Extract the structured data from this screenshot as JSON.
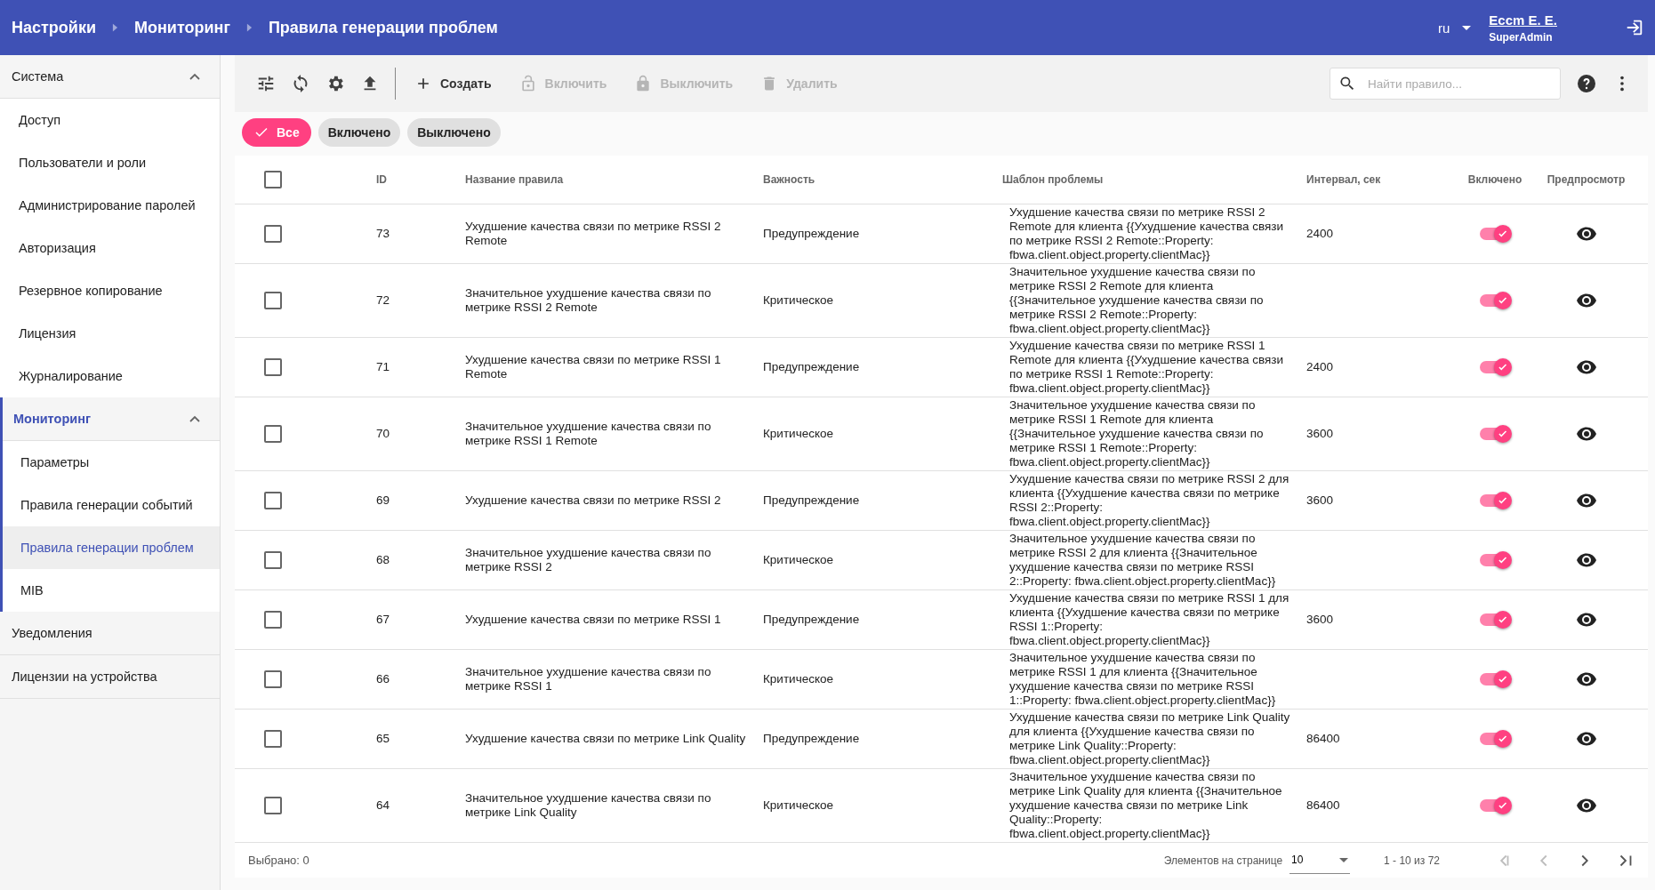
{
  "breadcrumbs": [
    "Настройки",
    "Мониторинг",
    "Правила генерации проблем"
  ],
  "language": "ru",
  "user": {
    "name": "Eccm E. E.",
    "role": "SuperAdmin"
  },
  "sidebar": {
    "sections": [
      {
        "label": "Система",
        "expanded": true,
        "selected": false,
        "children": [
          {
            "label": "Доступ",
            "selected": false
          },
          {
            "label": "Пользователи и роли",
            "selected": false
          },
          {
            "label": "Администрирование паролей",
            "selected": false
          },
          {
            "label": "Авторизация",
            "selected": false
          },
          {
            "label": "Резервное копирование",
            "selected": false
          },
          {
            "label": "Лицензия",
            "selected": false
          },
          {
            "label": "Журналирование",
            "selected": false
          }
        ]
      },
      {
        "label": "Мониторинг",
        "expanded": true,
        "selected": true,
        "children": [
          {
            "label": "Параметры",
            "selected": false
          },
          {
            "label": "Правила генерации событий",
            "selected": false
          },
          {
            "label": "Правила генерации проблем",
            "selected": true
          },
          {
            "label": "MIB",
            "selected": false
          }
        ]
      },
      {
        "label": "Уведомления",
        "selected": false
      },
      {
        "label": "Лицензии на устройства",
        "selected": false
      }
    ]
  },
  "toolbar": {
    "actions": [
      {
        "kind": "create",
        "label": "Создать",
        "disabled": false
      },
      {
        "kind": "enable",
        "label": "Включить",
        "disabled": true
      },
      {
        "kind": "disable",
        "label": "Выключить",
        "disabled": true
      },
      {
        "kind": "delete",
        "label": "Удалить",
        "disabled": true
      }
    ],
    "search": {
      "placeholder": "Найти правило..."
    }
  },
  "filters": [
    {
      "label": "Все",
      "selected": true
    },
    {
      "label": "Включено",
      "selected": false
    },
    {
      "label": "Выключено",
      "selected": false
    }
  ],
  "table": {
    "select_all_checked": false,
    "columns": [
      "ID",
      "Название правила",
      "Важность",
      "Шаблон проблемы",
      "Интервал, сек",
      "Включено",
      "Предпросмотр"
    ],
    "rows": [
      {
        "checked": false,
        "id": "73",
        "name": "Ухудшение качества связи по метрике RSSI 2 Remote",
        "severity": "Предупреждение",
        "template": "Ухудшение качества связи по метрике RSSI 2 Remote для клиента {{Ухудшение качества связи по метрике RSSI 2 Remote::Property: fbwa.client.object.property.clientMac}}",
        "interval": "2400",
        "enabled": true
      },
      {
        "checked": false,
        "id": "72",
        "name": "Значительное ухудшение качества связи по метрике RSSI 2 Remote",
        "severity": "Критическое",
        "template": "Значительное ухудшение качества связи по метрике RSSI 2 Remote для клиента {{Значительное ухудшение качества связи по метрике RSSI 2 Remote::Property: fbwa.client.object.property.clientMac}}",
        "enabled": true
      },
      {
        "checked": false,
        "id": "71",
        "name": "Ухудшение качества связи по метрике RSSI 1 Remote",
        "severity": "Предупреждение",
        "template": "Ухудшение качества связи по метрике RSSI 1 Remote для клиента {{Ухудшение качества связи по метрике RSSI 1 Remote::Property: fbwa.client.object.property.clientMac}}",
        "interval": "2400",
        "enabled": true
      },
      {
        "checked": false,
        "id": "70",
        "name": "Значительное ухудшение качества связи по метрике RSSI 1 Remote",
        "severity": "Критическое",
        "template": "Значительное ухудшение качества связи по метрике RSSI 1 Remote для клиента {{Значительное ухудшение качества связи по метрике RSSI 1 Remote::Property: fbwa.client.object.property.clientMac}}",
        "interval": "3600",
        "enabled": true
      },
      {
        "checked": false,
        "id": "69",
        "name": "Ухудшение качества связи по метрике RSSI 2",
        "severity": "Предупреждение",
        "template": "Ухудшение качества связи по метрике RSSI 2 для клиента {{Ухудшение качества связи по метрике RSSI 2::Property: fbwa.client.object.property.clientMac}}",
        "interval": "3600",
        "enabled": true
      },
      {
        "checked": false,
        "id": "68",
        "name": "Значительное ухудшение качества связи по метрике RSSI 2",
        "severity": "Критическое",
        "template": "Значительное ухудшение качества связи по метрике RSSI 2 для клиента {{Значительное ухудшение качества связи по метрике RSSI 2::Property: fbwa.client.object.property.clientMac}}",
        "enabled": true
      },
      {
        "checked": false,
        "id": "67",
        "name": "Ухудшение качества связи по метрике RSSI 1",
        "severity": "Предупреждение",
        "template": "Ухудшение качества связи по метрике RSSI 1 для клиента {{Ухудшение качества связи по метрике RSSI 1::Property: fbwa.client.object.property.clientMac}}",
        "interval": "3600",
        "enabled": true
      },
      {
        "checked": false,
        "id": "66",
        "name": "Значительное ухудшение качества связи по метрике RSSI 1",
        "severity": "Критическое",
        "template": "Значительное ухудшение качества связи по метрике RSSI 1 для клиента {{Значительное ухудшение качества связи по метрике RSSI 1::Property: fbwa.client.object.property.clientMac}}",
        "enabled": true
      },
      {
        "checked": false,
        "id": "65",
        "name": "Ухудшение качества связи по метрике Link Quality",
        "severity": "Предупреждение",
        "template": "Ухудшение качества связи по метрике Link Quality для клиента {{Ухудшение качества связи по метрике Link Quality::Property: fbwa.client.object.property.clientMac}}",
        "interval": "86400",
        "enabled": true
      },
      {
        "checked": false,
        "id": "64",
        "name": "Значительное ухудшение качества связи по метрике Link Quality",
        "severity": "Критическое",
        "template": "Значительное ухудшение качества связи по метрике Link Quality для клиента {{Значительное ухудшение качества связи по метрике Link Quality::Property: fbwa.client.object.property.clientMac}}",
        "interval": "86400",
        "enabled": true
      }
    ]
  },
  "footer": {
    "selected": "Выбрано: 0",
    "page_size_label": "Элементов на странице",
    "page_size": "10",
    "range": "1 - 10 из 72",
    "pager": [
      {
        "kind": "first",
        "disabled": true
      },
      {
        "kind": "prev",
        "disabled": true
      },
      {
        "kind": "next",
        "disabled": false
      },
      {
        "kind": "last",
        "disabled": false
      }
    ]
  }
}
